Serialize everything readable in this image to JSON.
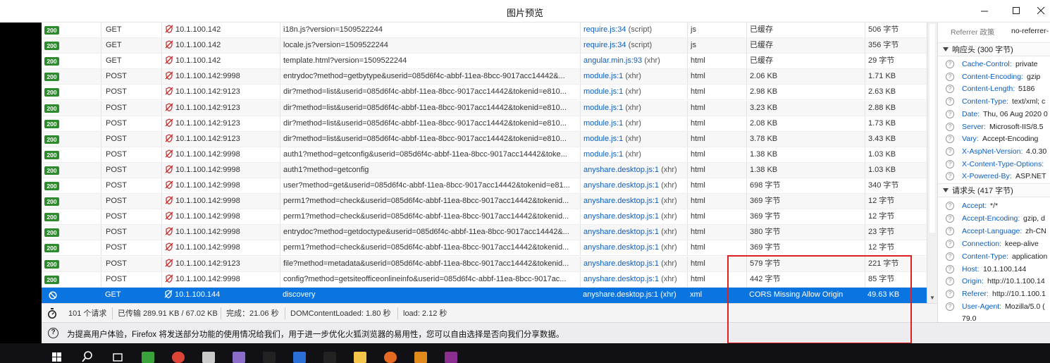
{
  "window": {
    "title": "图片预览"
  },
  "requests": [
    {
      "status": "200",
      "method": "GET",
      "domain": "10.1.100.142",
      "file": "i18n.js?version=1509522244",
      "initiator": "require.js:34",
      "initiator_type": "(script)",
      "type": "js",
      "transferred": "已缓存",
      "size": "506 字节"
    },
    {
      "status": "200",
      "method": "GET",
      "domain": "10.1.100.142",
      "file": "locale.js?version=1509522244",
      "initiator": "require.js:34",
      "initiator_type": "(script)",
      "type": "js",
      "transferred": "已缓存",
      "size": "356 字节"
    },
    {
      "status": "200",
      "method": "GET",
      "domain": "10.1.100.142",
      "file": "template.html?version=1509522244",
      "initiator": "angular.min.js:93",
      "initiator_type": "(xhr)",
      "type": "html",
      "transferred": "已缓存",
      "size": "29 字节"
    },
    {
      "status": "200",
      "method": "POST",
      "domain": "10.1.100.142:9998",
      "file": "entrydoc?method=getbytype&userid=085d6f4c-abbf-11ea-8bcc-9017acc14442&...",
      "initiator": "module.js:1",
      "initiator_type": "(xhr)",
      "type": "html",
      "transferred": "2.06 KB",
      "size": "1.71 KB"
    },
    {
      "status": "200",
      "method": "POST",
      "domain": "10.1.100.142:9123",
      "file": "dir?method=list&userid=085d6f4c-abbf-11ea-8bcc-9017acc14442&tokenid=e810...",
      "initiator": "module.js:1",
      "initiator_type": "(xhr)",
      "type": "html",
      "transferred": "2.98 KB",
      "size": "2.63 KB"
    },
    {
      "status": "200",
      "method": "POST",
      "domain": "10.1.100.142:9123",
      "file": "dir?method=list&userid=085d6f4c-abbf-11ea-8bcc-9017acc14442&tokenid=e810...",
      "initiator": "module.js:1",
      "initiator_type": "(xhr)",
      "type": "html",
      "transferred": "3.23 KB",
      "size": "2.88 KB"
    },
    {
      "status": "200",
      "method": "POST",
      "domain": "10.1.100.142:9123",
      "file": "dir?method=list&userid=085d6f4c-abbf-11ea-8bcc-9017acc14442&tokenid=e810...",
      "initiator": "module.js:1",
      "initiator_type": "(xhr)",
      "type": "html",
      "transferred": "2.08 KB",
      "size": "1.73 KB"
    },
    {
      "status": "200",
      "method": "POST",
      "domain": "10.1.100.142:9123",
      "file": "dir?method=list&userid=085d6f4c-abbf-11ea-8bcc-9017acc14442&tokenid=e810...",
      "initiator": "module.js:1",
      "initiator_type": "(xhr)",
      "type": "html",
      "transferred": "3.78 KB",
      "size": "3.43 KB"
    },
    {
      "status": "200",
      "method": "POST",
      "domain": "10.1.100.142:9998",
      "file": "auth1?method=getconfig&userid=085d6f4c-abbf-11ea-8bcc-9017acc14442&toke...",
      "initiator": "module.js:1",
      "initiator_type": "(xhr)",
      "type": "html",
      "transferred": "1.38 KB",
      "size": "1.03 KB"
    },
    {
      "status": "200",
      "method": "POST",
      "domain": "10.1.100.142:9998",
      "file": "auth1?method=getconfig",
      "initiator": "anyshare.desktop.js:1",
      "initiator_type": "(xhr)",
      "type": "html",
      "transferred": "1.38 KB",
      "size": "1.03 KB"
    },
    {
      "status": "200",
      "method": "POST",
      "domain": "10.1.100.142:9998",
      "file": "user?method=get&userid=085d6f4c-abbf-11ea-8bcc-9017acc14442&tokenid=e81...",
      "initiator": "anyshare.desktop.js:1",
      "initiator_type": "(xhr)",
      "type": "html",
      "transferred": "698 字节",
      "size": "340 字节"
    },
    {
      "status": "200",
      "method": "POST",
      "domain": "10.1.100.142:9998",
      "file": "perm1?method=check&userid=085d6f4c-abbf-11ea-8bcc-9017acc14442&tokenid...",
      "initiator": "anyshare.desktop.js:1",
      "initiator_type": "(xhr)",
      "type": "html",
      "transferred": "369 字节",
      "size": "12 字节"
    },
    {
      "status": "200",
      "method": "POST",
      "domain": "10.1.100.142:9998",
      "file": "perm1?method=check&userid=085d6f4c-abbf-11ea-8bcc-9017acc14442&tokenid...",
      "initiator": "anyshare.desktop.js:1",
      "initiator_type": "(xhr)",
      "type": "html",
      "transferred": "369 字节",
      "size": "12 字节"
    },
    {
      "status": "200",
      "method": "POST",
      "domain": "10.1.100.142:9998",
      "file": "entrydoc?method=getdoctype&userid=085d6f4c-abbf-11ea-8bcc-9017acc14442&...",
      "initiator": "anyshare.desktop.js:1",
      "initiator_type": "(xhr)",
      "type": "html",
      "transferred": "380 字节",
      "size": "23 字节"
    },
    {
      "status": "200",
      "method": "POST",
      "domain": "10.1.100.142:9998",
      "file": "perm1?method=check&userid=085d6f4c-abbf-11ea-8bcc-9017acc14442&tokenid...",
      "initiator": "anyshare.desktop.js:1",
      "initiator_type": "(xhr)",
      "type": "html",
      "transferred": "369 字节",
      "size": "12 字节"
    },
    {
      "status": "200",
      "method": "POST",
      "domain": "10.1.100.142:9123",
      "file": "file?method=metadata&userid=085d6f4c-abbf-11ea-8bcc-9017acc14442&tokenid...",
      "initiator": "anyshare.desktop.js:1",
      "initiator_type": "(xhr)",
      "type": "html",
      "transferred": "579 字节",
      "size": "221 字节"
    },
    {
      "status": "200",
      "method": "POST",
      "domain": "10.1.100.142:9998",
      "file": "config?method=getsiteofficeonlineinfo&userid=085d6f4c-abbf-11ea-8bcc-9017ac...",
      "initiator": "anyshare.desktop.js:1",
      "initiator_type": "(xhr)",
      "type": "html",
      "transferred": "442 字节",
      "size": "85 字节"
    }
  ],
  "selected_request": {
    "method": "GET",
    "domain": "10.1.100.144",
    "file": "discovery",
    "initiator": "anyshare.desktop.js:1",
    "initiator_type": "(xhr)",
    "type": "xml",
    "transferred": "CORS Missing Allow Origin",
    "size": "49.63 KB"
  },
  "summary": {
    "requests": "101 个请求",
    "transferred": "已传输 289.91 KB / 67.02 KB",
    "finish": "完成：21.06 秒",
    "dom_content_loaded": "DOMContentLoaded: 1.80 秒",
    "load": "load: 2.12 秒"
  },
  "notification": {
    "message": "为提高用户体验，Firefox 将发送部分功能的使用情况给我们，用于进一步优化火狐浏览器的易用性，您可以自由选择是否向我们分享数据。"
  },
  "side_panel": {
    "referrer_policy_label": "Referrer 政策",
    "referrer_policy_value": "no-referrer-",
    "response_section": "响应头 (300 字节)",
    "response_headers": [
      {
        "name": "Cache-Control:",
        "value": "private"
      },
      {
        "name": "Content-Encoding:",
        "value": "gzip"
      },
      {
        "name": "Content-Length:",
        "value": "5186"
      },
      {
        "name": "Content-Type:",
        "value": "text/xml; c"
      },
      {
        "name": "Date:",
        "value": "Thu, 06 Aug 2020 0"
      },
      {
        "name": "Server:",
        "value": "Microsoft-IIS/8.5"
      },
      {
        "name": "Vary:",
        "value": "Accept-Encoding"
      },
      {
        "name": "X-AspNet-Version:",
        "value": "4.0.30"
      },
      {
        "name": "X-Content-Type-Options:",
        "value": ""
      },
      {
        "name": "X-Powered-By:",
        "value": "ASP.NET"
      }
    ],
    "request_section": "请求头 (417 字节)",
    "request_headers": [
      {
        "name": "Accept:",
        "value": "*/*"
      },
      {
        "name": "Accept-Encoding:",
        "value": "gzip, d"
      },
      {
        "name": "Accept-Language:",
        "value": "zh-CN"
      },
      {
        "name": "Connection:",
        "value": "keep-alive"
      },
      {
        "name": "Content-Type:",
        "value": "application"
      },
      {
        "name": "Host:",
        "value": "10.1.100.144"
      },
      {
        "name": "Origin:",
        "value": "http://10.1.100.14"
      },
      {
        "name": "Referer:",
        "value": "http://10.1.100.1"
      },
      {
        "name": "User-Agent:",
        "value": "Mozilla/5.0 ("
      }
    ],
    "user_agent_continued": "79.0"
  },
  "colors": {
    "status_ok": "#2d8b2d",
    "selected_row": "#0a74e0",
    "link": "#0a5ec2",
    "highlight": "#e02020"
  },
  "taskbar_icons": [
    "windows-start-icon",
    "search-icon",
    "task-view-icon",
    "app-icon",
    "chrome-icon",
    "app-icon",
    "app-icon",
    "terminal-icon",
    "app-icon",
    "terminal-icon",
    "folder-icon",
    "firefox-icon",
    "app-icon",
    "winrar-icon"
  ]
}
